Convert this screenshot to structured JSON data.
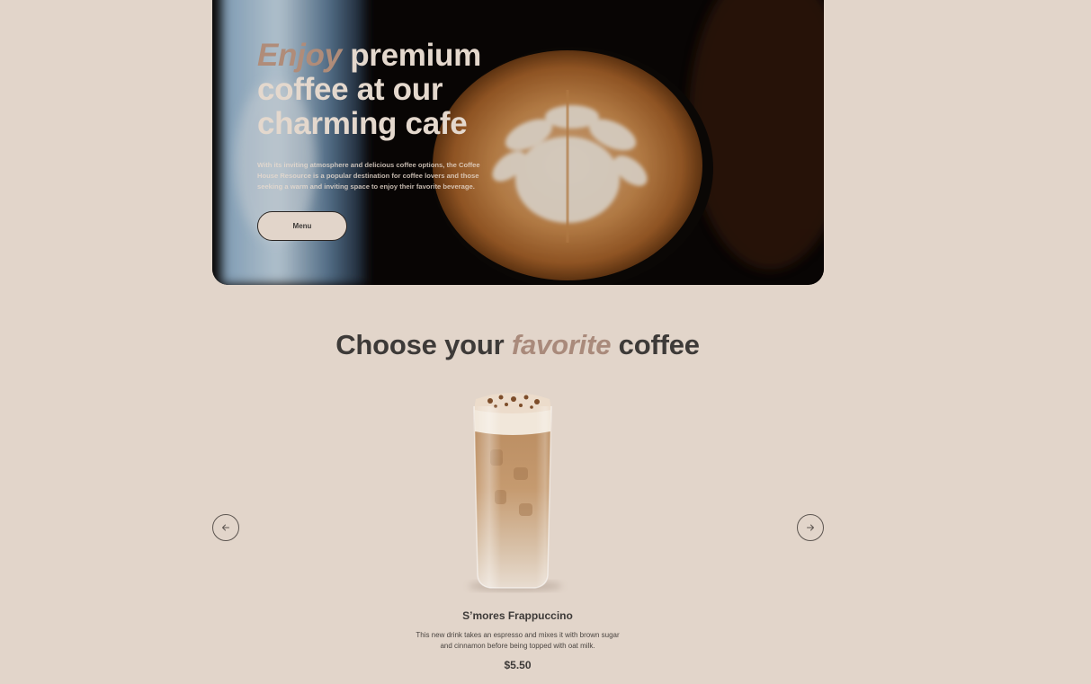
{
  "hero": {
    "title_accent": "Enjoy",
    "title_rest": " premium coffee at our charming cafe",
    "description": "With its inviting atmosphere and delicious coffee options, the Coffee House Resource is a popular destination for coffee lovers and those seeking a warm and inviting space to enjoy their favorite beverage.",
    "menu_label": "Menu"
  },
  "section": {
    "title_start": "Choose your ",
    "title_accent": "favorite",
    "title_end": " coffee"
  },
  "carousel": {
    "prev_icon": "arrow-left-icon",
    "next_icon": "arrow-right-icon"
  },
  "product": {
    "name": "S’mores Frappuccino",
    "description": "This new drink takes an espresso and mixes it with brown sugar and cinnamon before being topped with oat milk.",
    "price": "$5.50"
  },
  "colors": {
    "background": "#e2d5ca",
    "accent": "#b08c79",
    "text": "#3d3a38"
  }
}
